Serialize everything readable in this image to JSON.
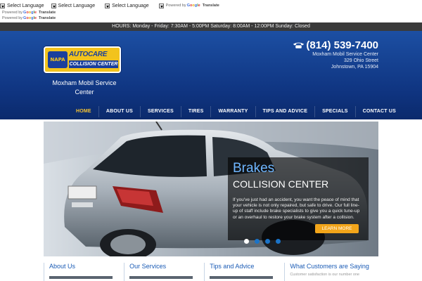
{
  "translate": {
    "selects": [
      "Select Language",
      "Select Language",
      "Select Language"
    ],
    "powered_by": "Powered by",
    "translate_label": "Translate",
    "google": [
      "G",
      "o",
      "o",
      "g",
      "l",
      "e"
    ]
  },
  "hours_text": "HOURS: Monday - Friday: 7:30AM - 5:00PM Saturday: 8:00AM - 12:00PM Sunday: Closed",
  "header": {
    "logo": {
      "napa": "NAPA",
      "autocare": "AUTOCARE",
      "collision": "COLLISION CENTER"
    },
    "business_name": "Moxham Mobil Service Center",
    "phone": "(814) 539-7400",
    "address_lines": [
      "Moxham Mobil Service Center",
      "329 Ohio Street",
      "Johnstown, PA 15904"
    ]
  },
  "nav": {
    "items": [
      "HOME",
      "ABOUT US",
      "SERVICES",
      "TIRES",
      "WARRANTY",
      "TIPS AND ADVICE",
      "SPECIALS",
      "CONTACT US"
    ],
    "active": 0
  },
  "hero": {
    "title1": "Brakes",
    "title2": "COLLISION CENTER",
    "text": "If you've just had an accident, you want the peace of mind that your vehicle is not only repaired, but safe to drive. Our full line-up of staff include brake specialists to give you a quick tune-up or an overhaul to restore your brake system after a collision.",
    "cta": "LEARN MORE",
    "slide_count": 4,
    "active_slide": 0
  },
  "columns": [
    {
      "title": "About Us"
    },
    {
      "title": "Our Services"
    },
    {
      "title": "Tips and Advice"
    },
    {
      "title": "What Customers are Saying",
      "sub": "Customer satisfaction is our number one"
    }
  ],
  "colors": {
    "header_blue": "#0f3480",
    "nav_active": "#f5c332",
    "hero_title": "#6fb6ff",
    "cta": "#f2a51a",
    "column_heading": "#1a5bb5"
  }
}
